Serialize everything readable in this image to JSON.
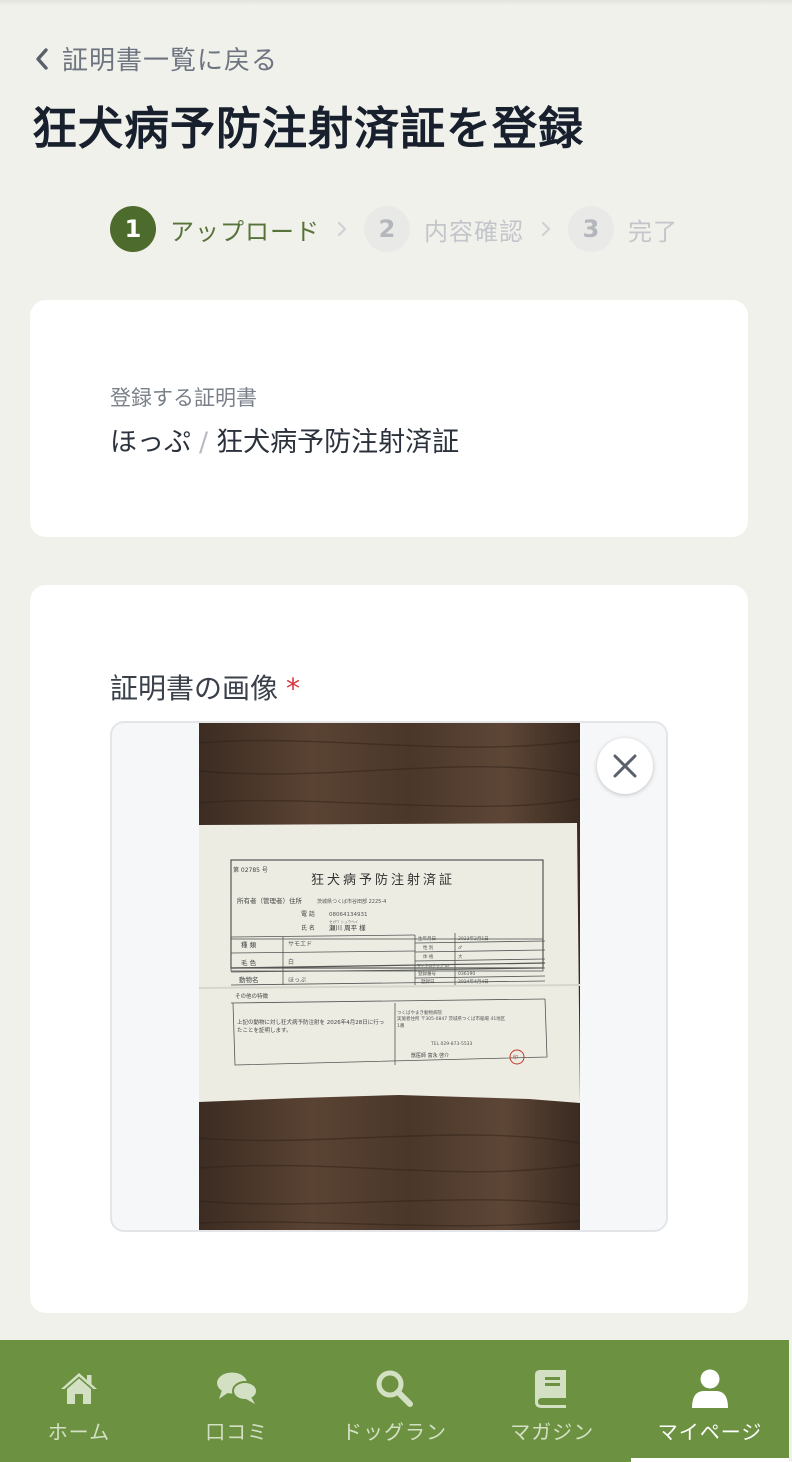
{
  "nav": {
    "back_label": "証明書一覧に戻る"
  },
  "page": {
    "title": "狂犬病予防注射済証を登録"
  },
  "stepper": {
    "steps": [
      {
        "number": "1",
        "label": "アップロード",
        "state": "active"
      },
      {
        "number": "2",
        "label": "内容確認",
        "state": "inactive"
      },
      {
        "number": "3",
        "label": "完了",
        "state": "inactive"
      }
    ]
  },
  "certificate": {
    "label": "登録する証明書",
    "pet_name": "ほっぷ",
    "separator": "/",
    "cert_type": "狂犬病予防注射済証"
  },
  "image_field": {
    "label": "証明書の画像",
    "required_mark": "*",
    "document": {
      "heading": "狂犬病予防注射済証",
      "number": "第 02785 号",
      "owner_label": "所有者（管理者）住所",
      "owner_address": "茨城県つくば市谷田部 2225-4",
      "phone_label": "電 話",
      "phone": "08064134931",
      "name_label": "氏 名",
      "name_kana": "セガワ シュウヘイ",
      "name": "瀬川 周平 様",
      "rows": [
        {
          "label": "種 類",
          "value": "サモエド"
        },
        {
          "label": "毛 色",
          "value": "白"
        },
        {
          "label": "動物名",
          "value": "ほっぷ"
        },
        {
          "label": "その他の特徴",
          "value": ""
        }
      ],
      "right_rows": [
        {
          "label": "生年月日",
          "value": "2023年2月1日"
        },
        {
          "label": "性 別",
          "value": "♂"
        },
        {
          "label": "体 格",
          "value": "大"
        },
        {
          "label": "マイクロチップ ID",
          "value": ""
        },
        {
          "label": "登録番号",
          "value": "036190"
        },
        {
          "label": "登録日",
          "value": "2024年4月4日"
        }
      ],
      "statement": "上記の動物に対し狂犬病予防注射を 2026年4月28日に行ったことを証明します。",
      "clinic_name": "つくばやまき動物病院",
      "clinic_address": "実施者住所 〒305-0847 茨城県つくば市稲場 41地区1番",
      "clinic_tel": "TEL 029-873-5533",
      "vet": "獣医師 富永 啓介",
      "seal": "印"
    }
  },
  "tabbar": {
    "items": [
      {
        "label": "ホーム",
        "icon": "home-icon",
        "active": false
      },
      {
        "label": "口コミ",
        "icon": "chat-icon",
        "active": false
      },
      {
        "label": "ドッグラン",
        "icon": "search-icon",
        "active": false
      },
      {
        "label": "マガジン",
        "icon": "book-icon",
        "active": false
      },
      {
        "label": "マイページ",
        "icon": "user-icon",
        "active": true
      }
    ]
  },
  "colors": {
    "brand_green": "#6b9141",
    "step_active": "#4d6b2c",
    "required": "#d9363e",
    "background": "#f1f1ec"
  }
}
